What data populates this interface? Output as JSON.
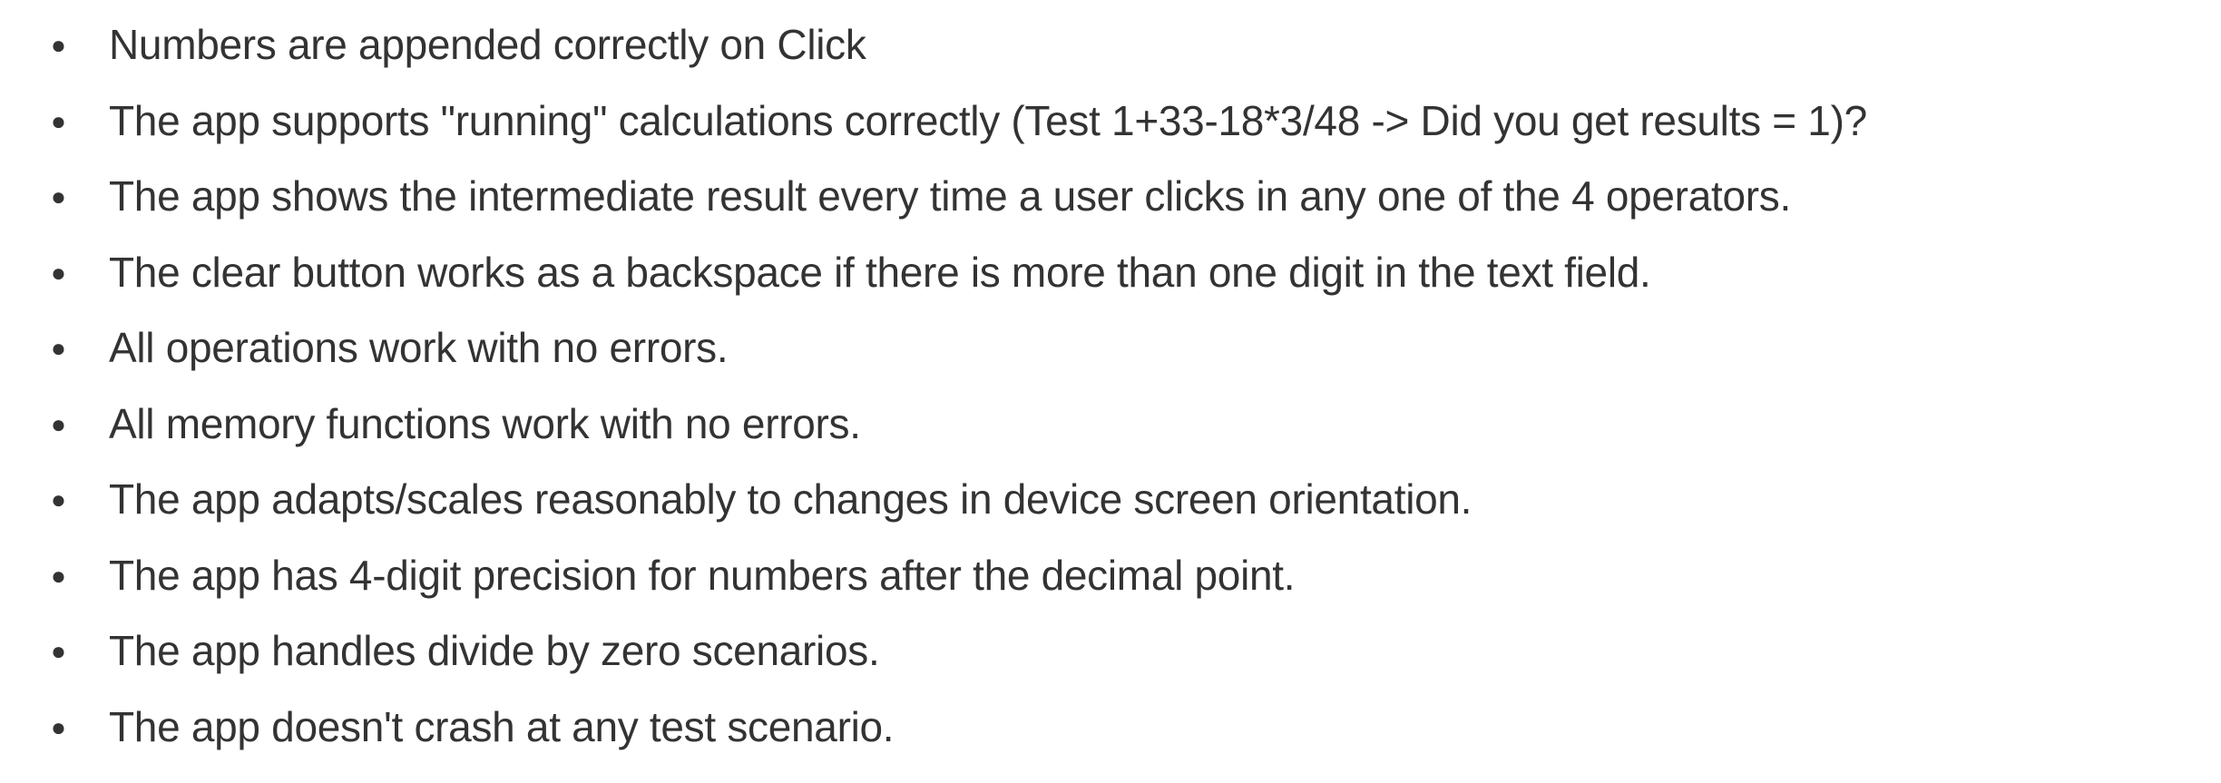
{
  "bullets": [
    "Numbers are appended correctly on Click",
    "The app supports \"running\" calculations correctly (Test 1+33-18*3/48 -> Did you get results = 1)?",
    "The app shows the intermediate result every time a user clicks in any one of the 4 operators.",
    "The clear button works as a backspace if there is more than one digit in the text field.",
    "All operations work with no errors.",
    "All memory functions work with no errors.",
    "The app adapts/scales reasonably to changes in device screen orientation.",
    "The app has 4-digit precision for numbers after the decimal point.",
    "The app handles divide by zero scenarios.",
    "The app doesn't crash at any test scenario."
  ]
}
